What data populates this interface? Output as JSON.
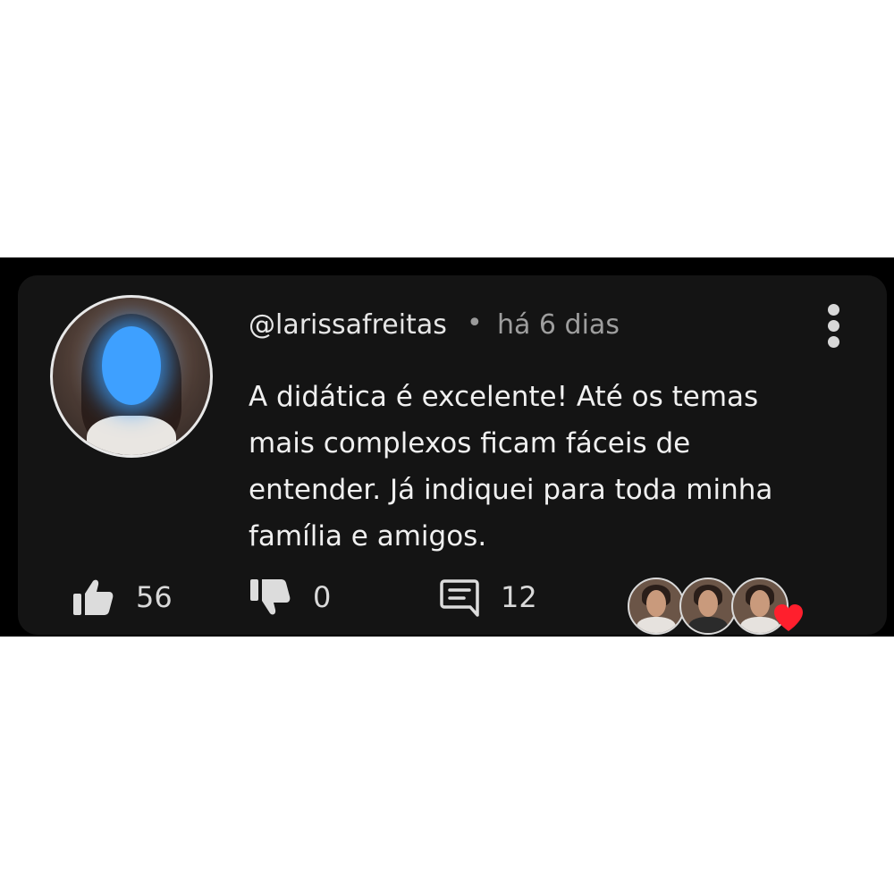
{
  "comment": {
    "username": "@larissafreitas",
    "separator": "•",
    "time": "há 6 dias",
    "text_lines": [
      "A didática é excelente! Até os temas",
      "mais complexos ficam fáceis de",
      "entender. Já indiquei para toda minha",
      "família e amigos."
    ]
  },
  "actions": {
    "likes": "56",
    "dislikes": "0",
    "replies": "12"
  },
  "icons": {
    "menu": "more-vertical-icon",
    "like": "thumbs-up-icon",
    "dislike": "thumbs-down-icon",
    "reply": "comment-icon",
    "reaction": "heart-icon"
  },
  "colors": {
    "card_background": "#141414",
    "text": "#f0f0f0",
    "muted": "#9e9e9e",
    "heart": "#ff1f2d",
    "avatar_blur": "#3ea0ff"
  }
}
